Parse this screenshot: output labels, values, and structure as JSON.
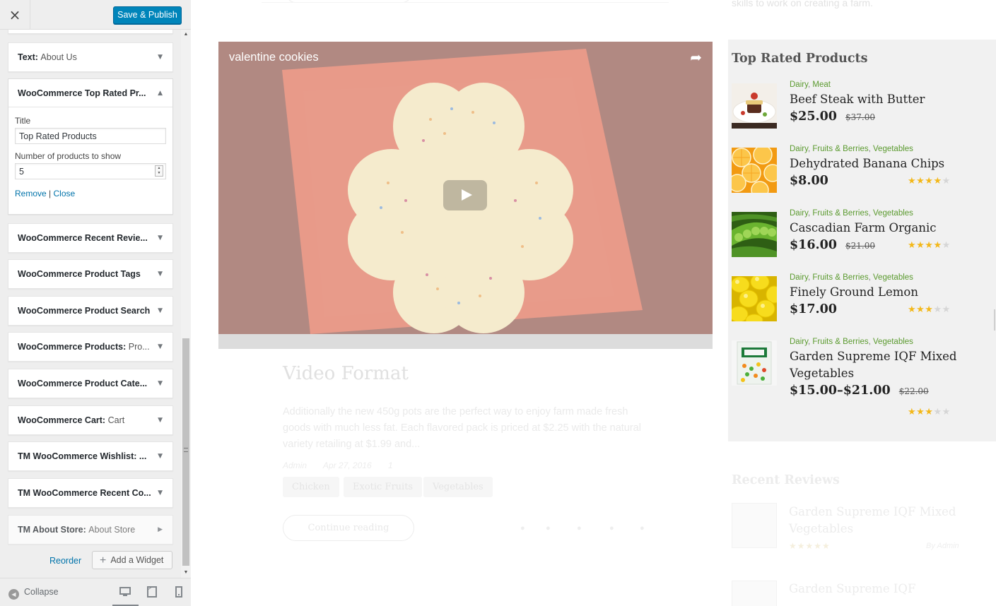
{
  "sidebar": {
    "close_label": "×",
    "publish_label": "Save & Publish",
    "widgets": [
      {
        "title": "Text:",
        "subtitle": "About Us"
      },
      {
        "title": "WooCommerce Top Rated Pr...",
        "subtitle": ""
      },
      {
        "title": "WooCommerce Recent Revie...",
        "subtitle": ""
      },
      {
        "title": "WooCommerce Product Tags",
        "subtitle": ""
      },
      {
        "title": "WooCommerce Product Search",
        "subtitle": ""
      },
      {
        "title": "WooCommerce Products:",
        "subtitle": "Pro..."
      },
      {
        "title": "WooCommerce Product Cate...",
        "subtitle": ""
      },
      {
        "title": "WooCommerce Cart:",
        "subtitle": "Cart"
      },
      {
        "title": "TM WooCommerce Wishlist: ...",
        "subtitle": ""
      },
      {
        "title": "TM WooCommerce Recent Co...",
        "subtitle": ""
      },
      {
        "title": "TM About Store:",
        "subtitle": "About Store"
      }
    ],
    "open_widget": {
      "title_label": "Title",
      "title_value": "Top Rated Products",
      "number_label": "Number of products to show",
      "number_value": "5",
      "remove_label": "Remove",
      "separator": "|",
      "close_label": "Close"
    },
    "reorder_label": "Reorder",
    "add_widget_label": "Add a Widget",
    "collapse_label": "Collapse"
  },
  "preview": {
    "top_side_text": "skills to work on creating a farm.",
    "video": {
      "title": "valentine cookies"
    },
    "post": {
      "title": "Video Format",
      "excerpt": "Additionally the new 450g pots are the perfect way to enjoy farm made fresh goods with much less fat. Each flavored pack is priced at $2.25 with the natural variety retailing at $1.99 and...",
      "author": "Admin",
      "date": "Apr 27, 2016",
      "comments": "1",
      "tags": [
        "Chicken",
        "Exotic Fruits",
        "Vegetables"
      ],
      "continue_label": "Continue reading"
    },
    "top_rated": {
      "title": "Top Rated Products",
      "products": [
        {
          "cats": [
            "Dairy",
            "Meat"
          ],
          "name": "Beef Steak with Butter",
          "price": "$25.00",
          "old_price": "$37.00",
          "rating": 0
        },
        {
          "cats": [
            "Dairy",
            "Fruits & Berries",
            "Vegetables"
          ],
          "name": "Dehydrated Banana Chips",
          "price": "$8.00",
          "old_price": "",
          "rating": 4
        },
        {
          "cats": [
            "Dairy",
            "Fruits & Berries",
            "Vegetables"
          ],
          "name": "Cascadian Farm Organic",
          "price": "$16.00",
          "old_price": "$21.00",
          "rating": 4
        },
        {
          "cats": [
            "Dairy",
            "Fruits & Berries",
            "Vegetables"
          ],
          "name": "Finely Ground Lemon",
          "price": "$17.00",
          "old_price": "",
          "rating": 3
        },
        {
          "cats": [
            "Dairy",
            "Fruits & Berries",
            "Vegetables"
          ],
          "name": "Garden Supreme IQF Mixed Vegetables",
          "price": "$15.00–$21.00",
          "old_price": "$22.00",
          "rating": 3
        }
      ]
    },
    "recent_reviews": {
      "title": "Recent Reviews",
      "items": [
        {
          "name": "Garden Supreme IQF Mixed Vegetables",
          "by": "By Admin"
        },
        {
          "name": "Garden Supreme IQF",
          "by": ""
        }
      ]
    }
  },
  "colors": {
    "publish_bg": "#0085ba",
    "link": "#0073aa",
    "category_green": "#5b9a2f",
    "star": "#f3b81a"
  }
}
